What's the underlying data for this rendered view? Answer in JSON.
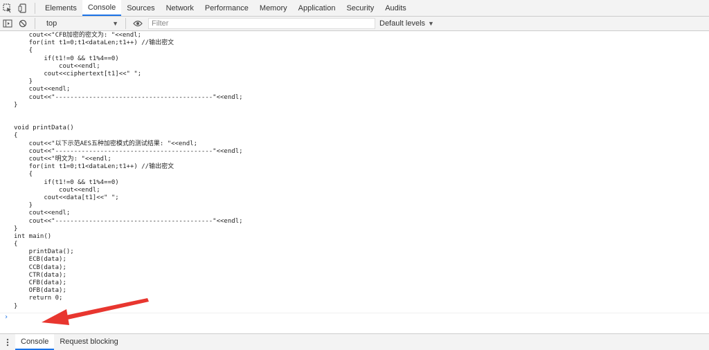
{
  "tabs": [
    {
      "label": "Elements"
    },
    {
      "label": "Console"
    },
    {
      "label": "Sources"
    },
    {
      "label": "Network"
    },
    {
      "label": "Performance"
    },
    {
      "label": "Memory"
    },
    {
      "label": "Application"
    },
    {
      "label": "Security"
    },
    {
      "label": "Audits"
    }
  ],
  "active_tab": "Console",
  "toolbar": {
    "context": "top",
    "filter_placeholder": "Filter",
    "levels_label": "Default levels"
  },
  "icons": {
    "inspect": "cursor-box-icon",
    "device": "device-toggle-icon",
    "sidebar": "show-sidebar-icon",
    "clear": "clear-console-icon",
    "eye": "live-expression-eye-icon",
    "more": "three-dots-icon"
  },
  "colors": {
    "accent": "#1a73e8",
    "annotation_arrow": "#e8362f"
  },
  "code_lines": [
    "    cout<<\"CFB加密的密文为: \"<<endl;",
    "    for(int t1=0;t1<dataLen;t1++) //输出密文",
    "    {",
    "        if(t1!=0 && t1%4==0)",
    "            cout<<endl;",
    "        cout<<ciphertext[t1]<<\" \";",
    "    }",
    "    cout<<endl;",
    "    cout<<\"------------------------------------------\"<<endl;",
    "}",
    "",
    "",
    "void printData()",
    "{",
    "    cout<<\"以下示范AES五种加密模式的测试结果: \"<<endl;",
    "    cout<<\"------------------------------------------\"<<endl;",
    "    cout<<\"明文为: \"<<endl;",
    "    for(int t1=0;t1<dataLen;t1++) //输出密文",
    "    {",
    "        if(t1!=0 && t1%4==0)",
    "            cout<<endl;",
    "        cout<<data[t1]<<\" \";",
    "    }",
    "    cout<<endl;",
    "    cout<<\"------------------------------------------\"<<endl;",
    "}",
    "int main()",
    "{",
    "    printData();",
    "    ECB(data);",
    "    CCB(data);",
    "    CTR(data);",
    "    CFB(data);",
    "    OFB(data);",
    "    return 0;",
    "}"
  ],
  "prompt_symbol": "›",
  "drawer_tabs": [
    {
      "label": "Console"
    },
    {
      "label": "Request blocking"
    }
  ]
}
